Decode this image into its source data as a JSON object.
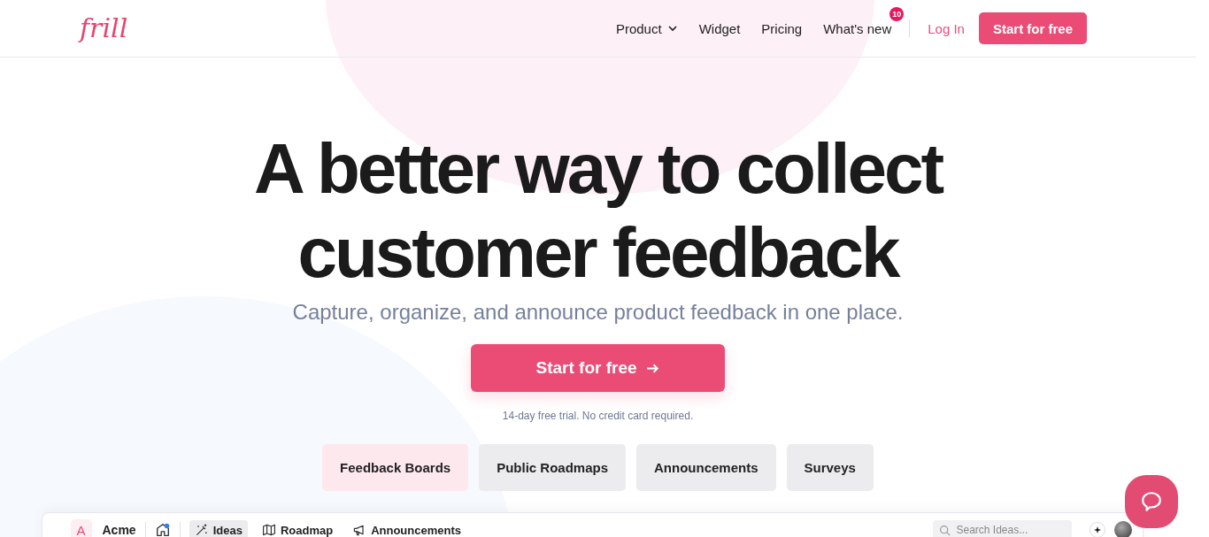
{
  "header": {
    "logo": "frill",
    "nav": [
      {
        "label": "Product",
        "kind": "dropdown"
      },
      {
        "label": "Widget",
        "kind": "link"
      },
      {
        "label": "Pricing",
        "kind": "link"
      },
      {
        "label": "What's new",
        "kind": "link",
        "badge": "10"
      }
    ],
    "login": "Log In",
    "cta": "Start for free"
  },
  "hero": {
    "title": "A better way to collect customer feedback",
    "subtitle": "Capture, organize, and announce product feedback in one place.",
    "cta": "Start for free",
    "note": "14-day free trial. No credit card required."
  },
  "feature_tabs": [
    {
      "label": "Feedback Boards",
      "selected": true
    },
    {
      "label": "Public Roadmaps",
      "selected": false
    },
    {
      "label": "Announcements",
      "selected": false
    },
    {
      "label": "Surveys",
      "selected": false
    }
  ],
  "app_preview": {
    "avatar_letter": "A",
    "workspace": "Acme",
    "nav": [
      {
        "label": "Ideas",
        "selected": true
      },
      {
        "label": "Roadmap",
        "selected": false
      },
      {
        "label": "Announcements",
        "selected": false
      }
    ],
    "search": {
      "placeholder": "Search Ideas..."
    }
  }
}
